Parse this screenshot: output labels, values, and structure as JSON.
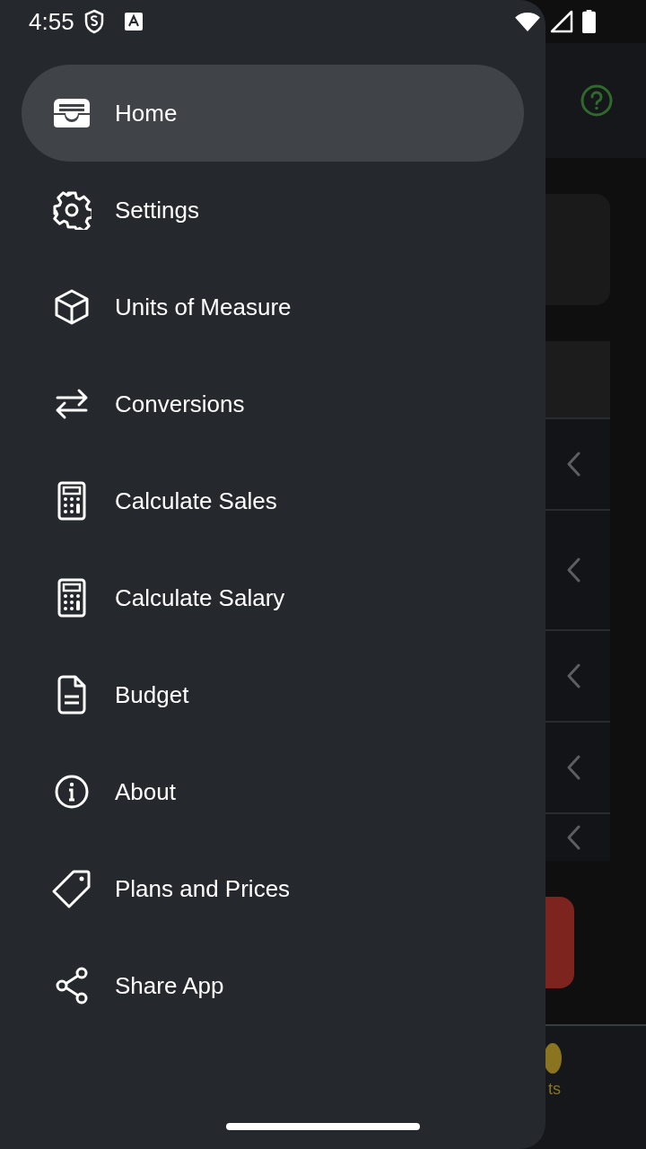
{
  "status_bar": {
    "time": "4:55"
  },
  "drawer": {
    "items": [
      {
        "label": "Home",
        "selected": true
      },
      {
        "label": "Settings",
        "selected": false
      },
      {
        "label": "Units of Measure",
        "selected": false
      },
      {
        "label": "Conversions",
        "selected": false
      },
      {
        "label": "Calculate Sales",
        "selected": false
      },
      {
        "label": "Calculate Salary",
        "selected": false
      },
      {
        "label": "Budget",
        "selected": false
      },
      {
        "label": "About",
        "selected": false
      },
      {
        "label": "Plans and Prices",
        "selected": false
      },
      {
        "label": "Share App",
        "selected": false
      }
    ]
  },
  "background_app": {
    "bottom_tab_label": "ts"
  }
}
